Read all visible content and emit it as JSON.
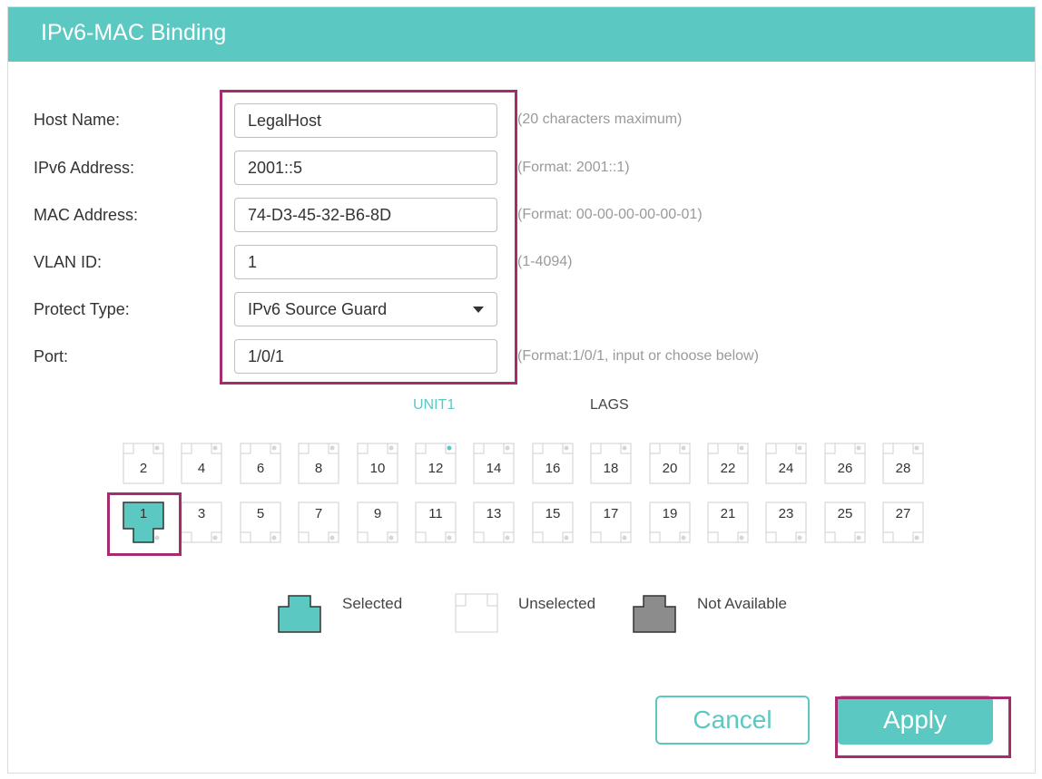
{
  "header": {
    "title": "IPv6-MAC Binding"
  },
  "form": {
    "host_name": {
      "label": "Host Name:",
      "value": "LegalHost",
      "hint": "(20 characters maximum)"
    },
    "ipv6_address": {
      "label": "IPv6 Address:",
      "value": "2001::5",
      "hint": "(Format: 2001::1)"
    },
    "mac_address": {
      "label": "MAC Address:",
      "value": "74-D3-45-32-B6-8D",
      "hint": "(Format: 00-00-00-00-00-01)"
    },
    "vlan_id": {
      "label": "VLAN ID:",
      "value": "1",
      "hint": "(1-4094)"
    },
    "protect_type": {
      "label": "Protect Type:",
      "value": "IPv6 Source Guard"
    },
    "port": {
      "label": "Port:",
      "value": "1/0/1",
      "hint": "(Format:1/0/1, input or choose below)"
    }
  },
  "tabs": {
    "unit1": "UNIT1",
    "lags": "LAGS"
  },
  "ports": {
    "top_row": [
      "2",
      "4",
      "6",
      "8",
      "10",
      "12",
      "14",
      "16",
      "18",
      "20",
      "22",
      "24",
      "26",
      "28"
    ],
    "bottom_row": [
      "1",
      "3",
      "5",
      "7",
      "9",
      "11",
      "13",
      "15",
      "17",
      "19",
      "21",
      "23",
      "25",
      "27"
    ],
    "selected": [
      "1"
    ],
    "link_up": [
      "12"
    ]
  },
  "legend": {
    "selected": "Selected",
    "unselected": "Unselected",
    "not_available": "Not Available"
  },
  "buttons": {
    "cancel": "Cancel",
    "apply": "Apply"
  },
  "colors": {
    "accent": "#5cc8c2",
    "highlight": "#a52c6e",
    "not_available": "#8c8c8c",
    "hint": "#9a9a9a"
  }
}
